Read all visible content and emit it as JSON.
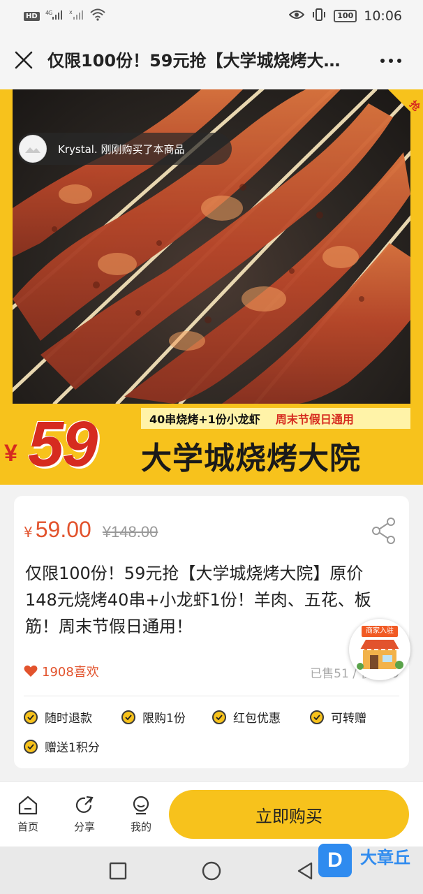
{
  "status_bar": {
    "hd_label": "HD",
    "signal_label": "4G",
    "battery": "100",
    "time": "10:06"
  },
  "title_bar": {
    "title": "仅限100份！59元抢【大学城烧烤大…"
  },
  "hero": {
    "corner_ribbon_text": "抢",
    "toast_user_text": "Krystal. 刚刚购买了本商品",
    "tagline_left": "40串烧烤+1份小龙虾",
    "tagline_right": "周末节假日通用",
    "banner_yen": "¥",
    "banner_price": "59",
    "banner_shop_name": "大学城烧烤大院"
  },
  "product": {
    "price_symbol": "¥",
    "price": "59.00",
    "original_price": "¥148.00",
    "description": "仅限100份！59元抢【大学城烧烤大院】原价148元烧烤40串+小龙虾1份！羊肉、五花、板筋！周末节假日通用！",
    "likes": "1908喜欢",
    "sold_info": "已售51 / 仅剩49",
    "features": [
      "随时退款",
      "限购1份",
      "红包优惠",
      "可转赠",
      "赠送1积分"
    ]
  },
  "merchant_badge": {
    "label": "商家入驻"
  },
  "bottom_bar": {
    "home_label": "首页",
    "share_label": "分享",
    "mine_label": "我的",
    "buy_label": "立即购买"
  },
  "watermark": {
    "logo_letter": "D",
    "text": "大章丘"
  },
  "colors": {
    "accent_yellow": "#f7c21c",
    "price_orange": "#e2532d",
    "banner_red": "#d62b1f"
  }
}
